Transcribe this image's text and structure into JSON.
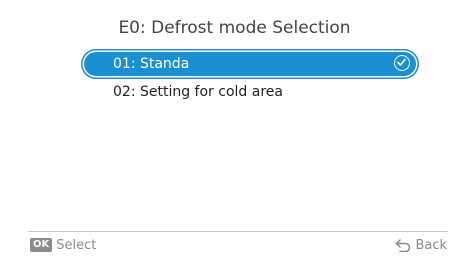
{
  "screen": {
    "title": "E0: Defrost mode Selection"
  },
  "options": [
    {
      "label": "01: Standa",
      "selected": true
    },
    {
      "label": "02: Setting for cold area",
      "selected": false
    }
  ],
  "footer": {
    "ok_badge": "OK",
    "select_label": "Select",
    "back_label": "Back"
  },
  "colors": {
    "accent": "#1b8fcf",
    "text": "#222222",
    "muted": "#8a8a8a"
  },
  "icons": {
    "check": "check-circle-icon",
    "back": "back-arrow-icon"
  }
}
